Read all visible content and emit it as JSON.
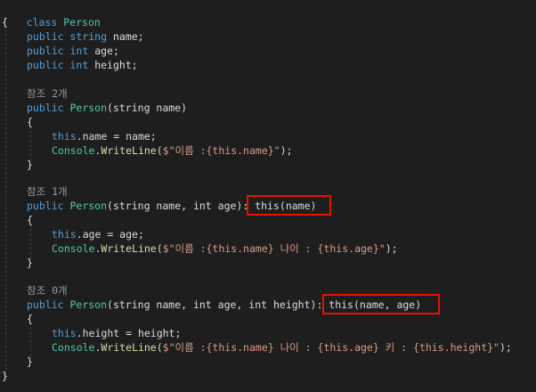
{
  "code": {
    "class_kw": "class",
    "class_name": "Person",
    "open_brace": "{",
    "close_brace": "}",
    "public_kw": "public",
    "string_kw": "string",
    "int_kw": "int",
    "this_kw": "this",
    "console": "Console",
    "writeline": "WriteLine",
    "field_name": "name",
    "field_age": "age",
    "field_height": "height",
    "ref_2": "참조 2개",
    "ref_1": "참조 1개",
    "ref_0": "참조 0개",
    "ctor1_params": "(string name)",
    "ctor2_params_a": "(string name, int age)",
    "ctor3_params_a": "(string name, int age, int height)",
    "ctor2_chain": ": this(name)",
    "ctor3_chain": ": this(name, age)",
    "assign_name": ".name = name;",
    "assign_age": ".age = age;",
    "assign_height": ".height = height;",
    "str1": "$\"이름 :{this.name}\"",
    "str2": "$\"이름 :{this.name} 나이 : {this.age}\"",
    "str3": "$\"이름 :{this.name} 나이 : {this.age} 키 : {this.height}\""
  }
}
